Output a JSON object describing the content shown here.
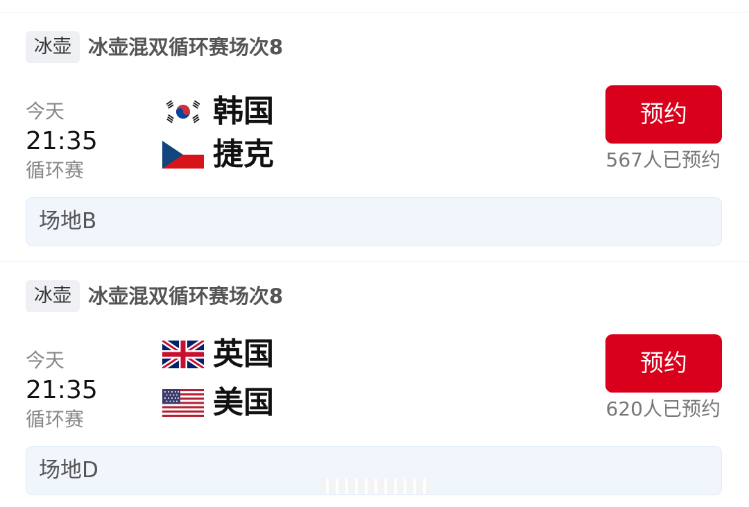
{
  "matches": [
    {
      "sport_tag": "冰壶",
      "title": "冰壶混双循环赛场次8",
      "day": "今天",
      "time": "21:35",
      "round": "循环赛",
      "teams": [
        {
          "name": "韩国",
          "flag_icon": "south-korea-flag-icon"
        },
        {
          "name": "捷克",
          "flag_icon": "czech-flag-icon"
        }
      ],
      "button_label": "预约",
      "booked_count": "567人已预约",
      "venue": "场地B"
    },
    {
      "sport_tag": "冰壶",
      "title": "冰壶混双循环赛场次8",
      "day": "今天",
      "time": "21:35",
      "round": "循环赛",
      "teams": [
        {
          "name": "英国",
          "flag_icon": "uk-flag-icon"
        },
        {
          "name": "美国",
          "flag_icon": "usa-flag-icon"
        }
      ],
      "button_label": "预约",
      "booked_count": "620人已预约",
      "venue": "场地D"
    }
  ],
  "colors": {
    "accent": "#d9001b",
    "tag_background": "#eef0f4",
    "venue_background": "#f1f6fd"
  }
}
